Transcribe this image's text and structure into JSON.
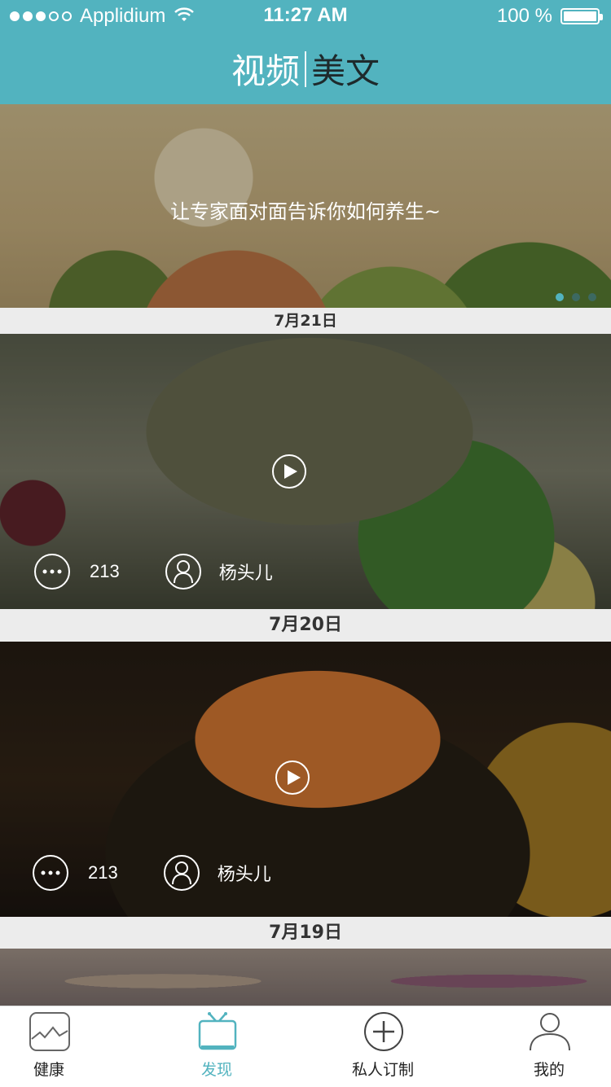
{
  "status_bar": {
    "carrier": "Applidium",
    "time": "11:27 AM",
    "battery": "100 %",
    "signal_icon": "signal-dots-icon",
    "wifi_icon": "wifi-icon"
  },
  "header": {
    "tabs": [
      {
        "label": "视频",
        "active": true
      },
      {
        "label": "美文",
        "active": false
      }
    ]
  },
  "banner": {
    "caption": "让专家面对面告诉你如何养生~",
    "page_count": 3,
    "current_page": 1
  },
  "feed": [
    {
      "date": "7月21日",
      "comments": "213",
      "author": "杨头儿"
    },
    {
      "date": "7月20日",
      "comments": "213",
      "author": "杨头儿"
    },
    {
      "date": "7月19日"
    }
  ],
  "tabbar": {
    "items": [
      {
        "label": "健康",
        "icon": "health-chart-icon",
        "active": false
      },
      {
        "label": "发现",
        "icon": "tv-icon",
        "active": true
      },
      {
        "label": "私人订制",
        "icon": "plus-circle-icon",
        "active": false
      },
      {
        "label": "我的",
        "icon": "person-icon",
        "active": false
      }
    ]
  },
  "colors": {
    "accent": "#52b3bf",
    "date_bar_bg": "#ececec",
    "text_dark": "#222222"
  }
}
